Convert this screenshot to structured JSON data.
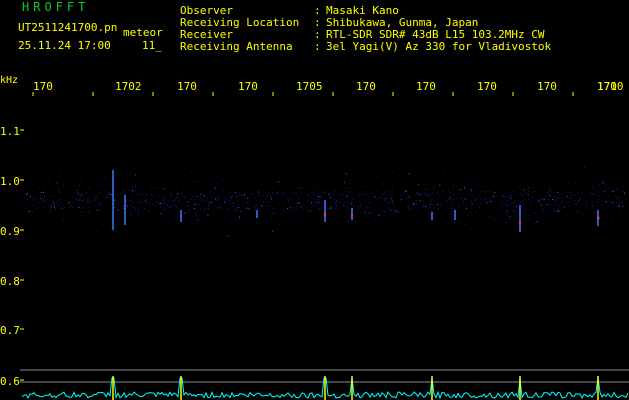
{
  "app": {
    "title": "HROFFT"
  },
  "capture": {
    "file_name": "UT2511241700.pn",
    "mode": "meteor",
    "date_time": "25.11.24 17:00",
    "count": "11_"
  },
  "metadata": [
    {
      "label": "Observer",
      "value": "Masaki Kano"
    },
    {
      "label": "Receiving Location",
      "value": "Shibukawa, Gunma, Japan"
    },
    {
      "label": "Receiver",
      "value": "RTL-SDR SDR# 43dB L15 103.2MHz CW"
    },
    {
      "label": "Receiving Antenna",
      "value": "3el Yagi(V) Az 330 for Vladivostok"
    }
  ],
  "separator": ":",
  "freq_axis": {
    "labels": [
      "170",
      "1702",
      "170",
      "170",
      "1705",
      "170",
      "170",
      "170",
      "170",
      "170",
      "1710"
    ]
  },
  "y_axis": {
    "unit": "kHz",
    "ticks": [
      "1.1",
      "1.0",
      "0.9",
      "0.8",
      "0.7",
      "0.6"
    ]
  },
  "colors": {
    "background": "#000000",
    "text": "#ffff00",
    "title": "#00cc33",
    "trace": "#00ffff"
  }
}
